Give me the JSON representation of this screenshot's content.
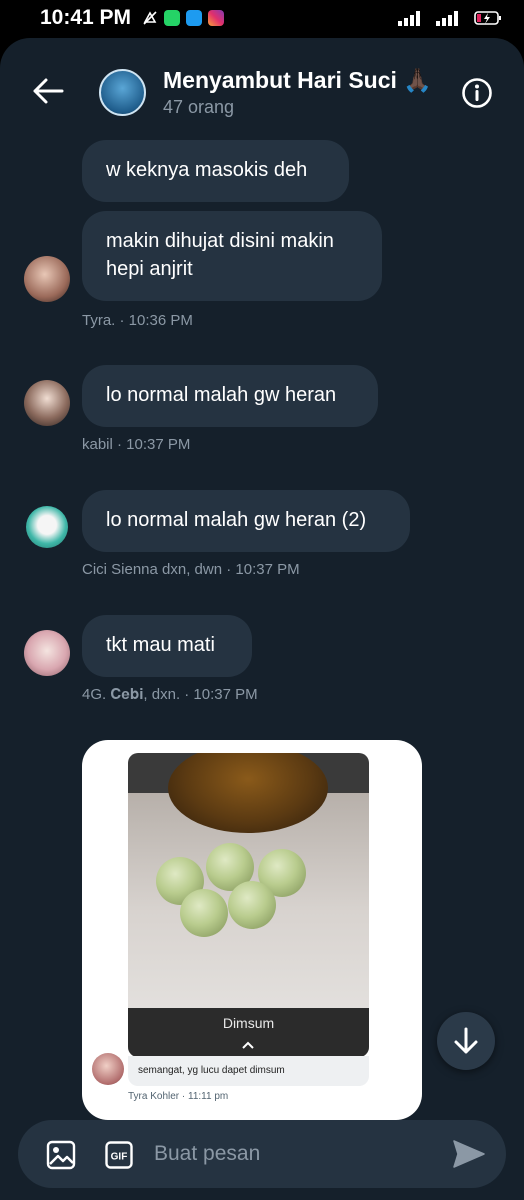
{
  "status_bar": {
    "time": "10:41 PM"
  },
  "header": {
    "title": "Menyambut Hari Suci 🙏🏿",
    "subtitle": "47 orang"
  },
  "messages": [
    {
      "text": "w keknya masokis deh"
    },
    {
      "text": "makin dihujat disini makin hepi anjrit",
      "meta": "Tyra. · 10:36 PM"
    },
    {
      "text": "lo normal malah gw heran",
      "meta": "kabil · 10:37 PM"
    },
    {
      "text": "lo normal malah gw heran (2)",
      "meta": "Cici Sienna dxn, dwn · 10:37 PM"
    },
    {
      "text": "tkt mau mati",
      "meta": "4G. 𝐂𝐞𝐛𝐢, dxn. · 10:37 PM"
    }
  ],
  "shared_media": {
    "photo_caption": "Dimsum",
    "reply_text": "semangat, yg lucu dapet dimsum",
    "reply_meta": "Tyra Kohler · 11:11 pm"
  },
  "composer": {
    "placeholder": "Buat pesan",
    "gif_label": "GIF"
  },
  "colors": {
    "background": "#15202b",
    "bubble": "#253341",
    "meta_text": "#8b98a5",
    "accent": "#1d9bf0"
  },
  "icons": [
    "back-arrow-icon",
    "info-icon",
    "image-icon",
    "gif-icon",
    "send-icon",
    "scroll-down-arrow-icon",
    "signal-icon",
    "battery-icon"
  ]
}
